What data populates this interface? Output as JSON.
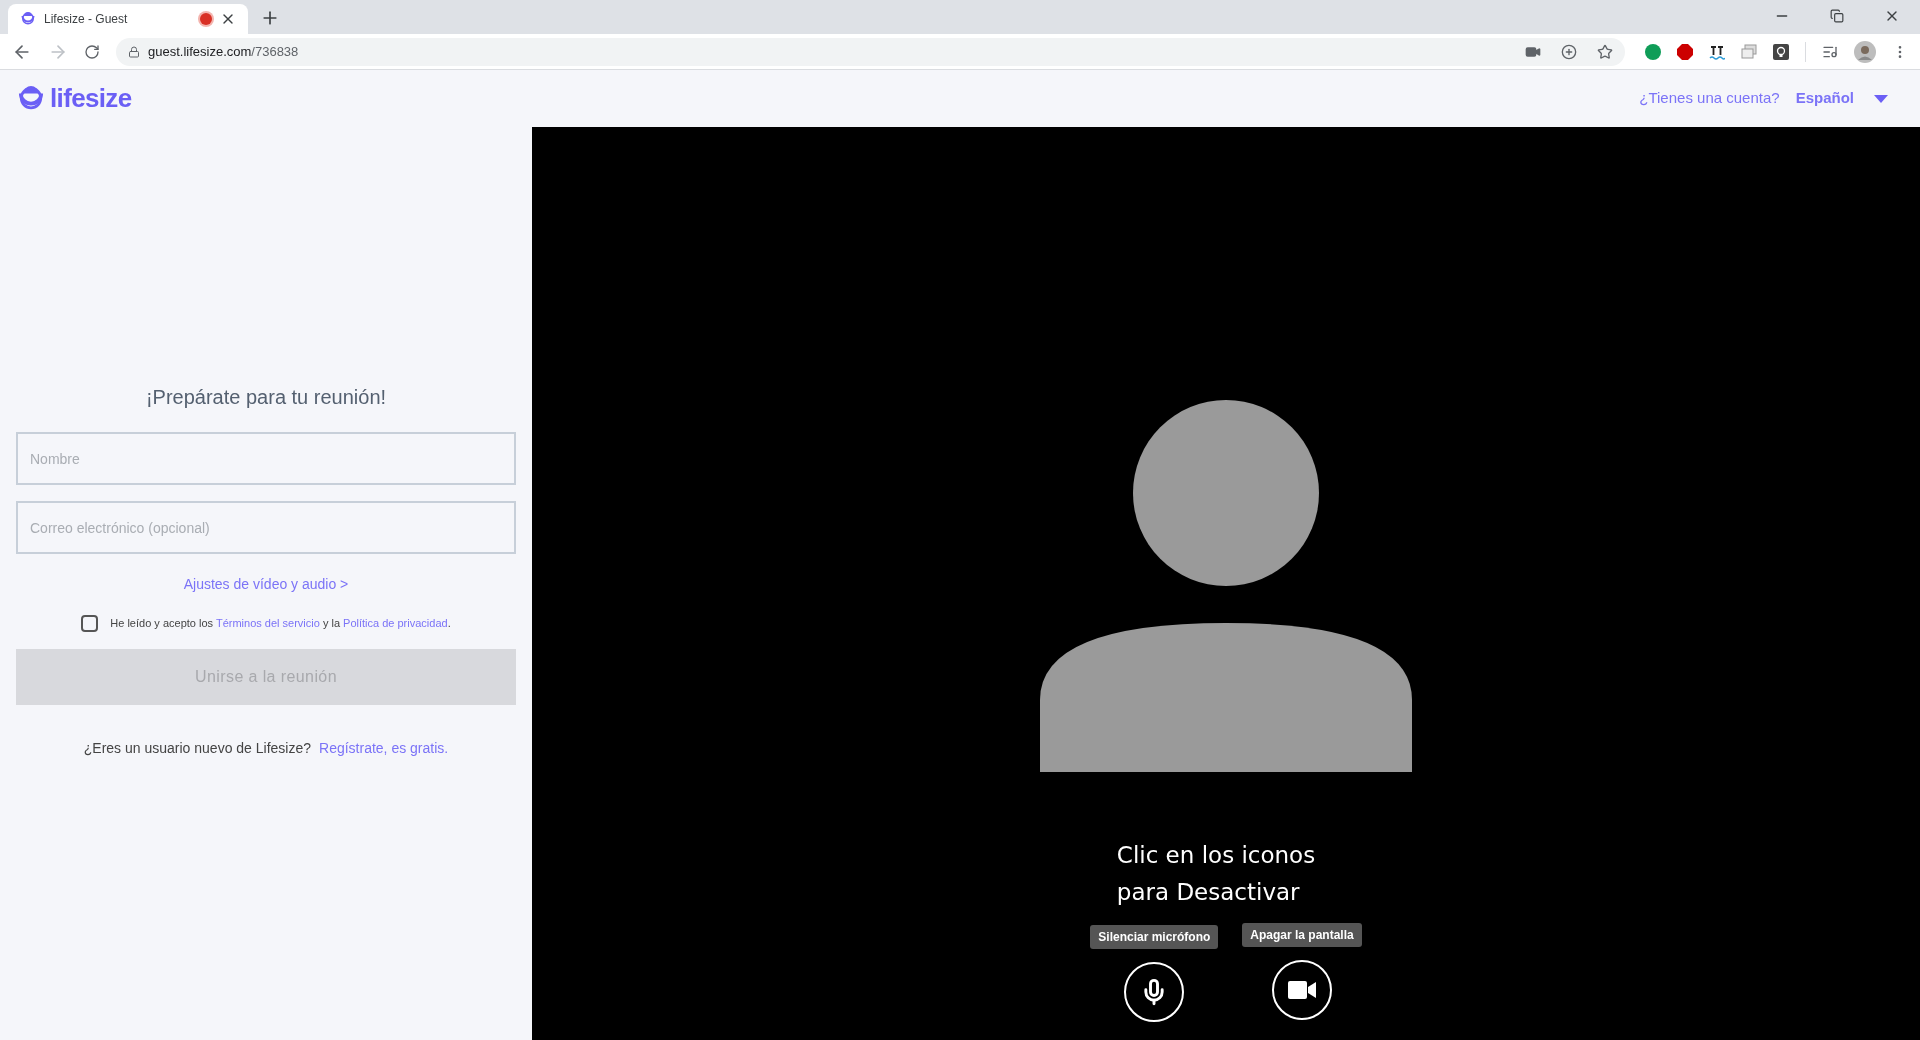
{
  "browser": {
    "tab": {
      "title": "Lifesize - Guest",
      "recording": true
    },
    "address": {
      "host": "guest.lifesize.com",
      "path": "/736838"
    }
  },
  "header": {
    "logo": "lifesize",
    "account_link": "¿Tienes una cuenta?",
    "language": "Español"
  },
  "form": {
    "heading": "¡Prepárate para tu reunión!",
    "name_placeholder": "Nombre",
    "email_placeholder": "Correo electrónico (opcional)",
    "settings_link": "Ajustes de vídeo y audio >",
    "terms": {
      "checked": false,
      "prefix": "He leído y acepto los ",
      "terms_link": "Términos del servicio",
      "middle": " y la ",
      "privacy_link": "Política de privacidad",
      "suffix": "."
    },
    "join_button": {
      "label": "Unirse a la reunión",
      "disabled": true
    },
    "signup": {
      "question": "¿Eres un usuario nuevo de Lifesize?",
      "link": "Regístrate, es gratis."
    }
  },
  "video": {
    "caption_lines": [
      "Clic en los iconos",
      "para Desactivar"
    ],
    "controls": [
      {
        "kind": "mic",
        "tooltip": "Silenciar micrófono"
      },
      {
        "kind": "camera",
        "tooltip": "Apagar la pantalla"
      }
    ]
  }
}
